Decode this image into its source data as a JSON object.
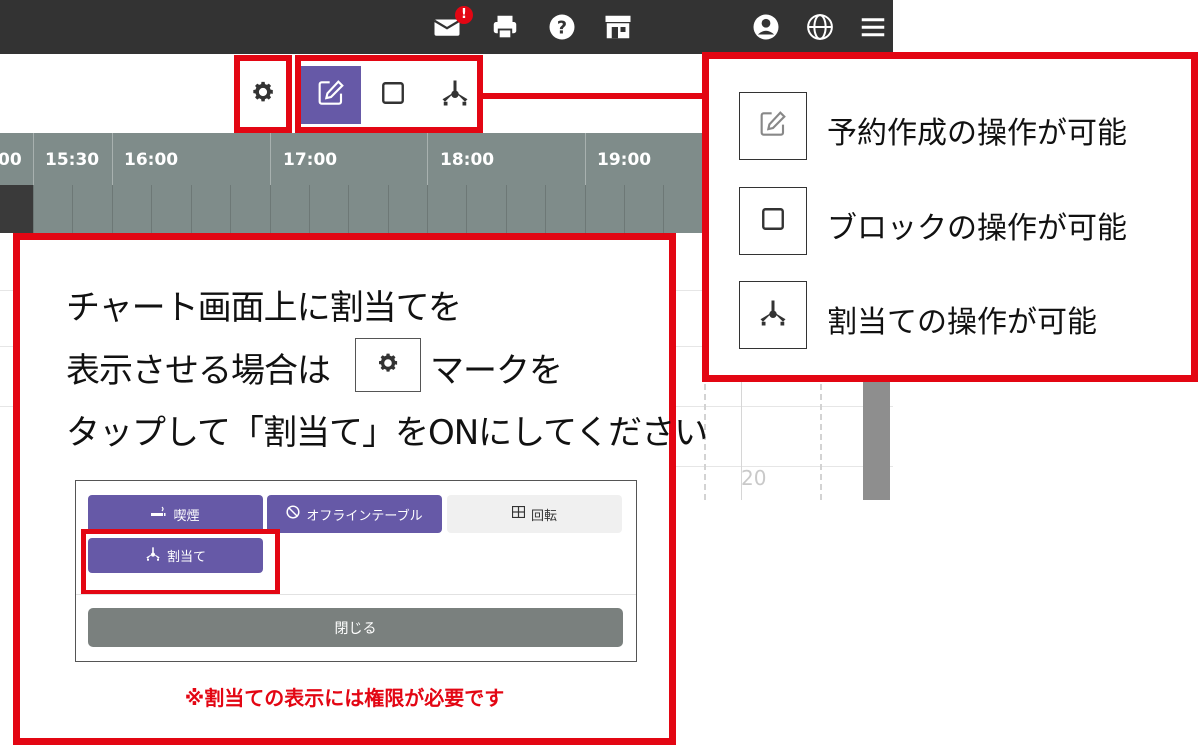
{
  "topbar": {
    "mail_badge": "!",
    "icons": [
      "mail-icon",
      "print-icon",
      "help-icon",
      "store-icon",
      "user-icon",
      "globe-icon",
      "menu-icon"
    ]
  },
  "toolbar": {
    "modes": [
      "edit-icon",
      "square-icon",
      "assign-icon"
    ],
    "active_mode": "edit-icon",
    "accent_color": "#6659a7",
    "highlight_color": "#e30613"
  },
  "timeline": {
    "labels": [
      "00",
      "15:30",
      "16:00",
      "17:00",
      "18:00",
      "19:00"
    ]
  },
  "legend": {
    "items": [
      {
        "icon": "edit-icon",
        "label": "予約作成の操作が可能"
      },
      {
        "icon": "square-icon",
        "label": "ブロックの操作が可能"
      },
      {
        "icon": "assign-icon",
        "label": "割当ての操作が可能"
      }
    ]
  },
  "background": {
    "cell_number": "20"
  },
  "instruction": {
    "line1": "チャート画面上に割当てを",
    "line2_pre": "表示させる場合は",
    "line2_post": "マークを",
    "line3": "タップして「割当て」をONにしてください"
  },
  "modal": {
    "smoking": "喫煙",
    "offline_table": "オフラインテーブル",
    "rotation": "回転",
    "assign": "割当て",
    "close": "閉じる"
  },
  "note": "※割当ての表示には権限が必要です"
}
